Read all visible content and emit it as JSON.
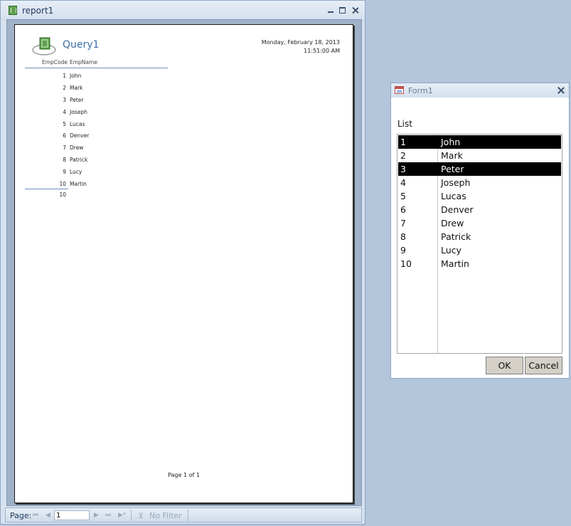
{
  "report_window": {
    "title": "report1",
    "report": {
      "title": "Query1",
      "date": "Monday, February 18, 2013",
      "time": "11:51:00 AM",
      "columns": [
        "EmpCode",
        "EmpName"
      ],
      "rows": [
        {
          "code": "1",
          "name": "John"
        },
        {
          "code": "2",
          "name": "Mark"
        },
        {
          "code": "3",
          "name": "Peter"
        },
        {
          "code": "4",
          "name": "Joseph"
        },
        {
          "code": "5",
          "name": "Lucas"
        },
        {
          "code": "6",
          "name": "Denver"
        },
        {
          "code": "7",
          "name": "Drew"
        },
        {
          "code": "8",
          "name": "Patrick"
        },
        {
          "code": "9",
          "name": "Lucy"
        },
        {
          "code": "10",
          "name": "Martin"
        }
      ],
      "total": "10",
      "footer": "Page 1 of 1"
    },
    "nav": {
      "label": "Page:",
      "page_value": "1",
      "filter_label": "No Filter"
    }
  },
  "form_window": {
    "title": "Form1",
    "list_label": "List",
    "items": [
      {
        "id": "1",
        "name": "John",
        "selected": true
      },
      {
        "id": "2",
        "name": "Mark",
        "selected": false
      },
      {
        "id": "3",
        "name": "Peter",
        "selected": true
      },
      {
        "id": "4",
        "name": "Joseph",
        "selected": false
      },
      {
        "id": "5",
        "name": "Lucas",
        "selected": false
      },
      {
        "id": "6",
        "name": "Denver",
        "selected": false
      },
      {
        "id": "7",
        "name": "Drew",
        "selected": false
      },
      {
        "id": "8",
        "name": "Patrick",
        "selected": false
      },
      {
        "id": "9",
        "name": "Lucy",
        "selected": false
      },
      {
        "id": "10",
        "name": "Martin",
        "selected": false
      }
    ],
    "ok_label": "OK",
    "cancel_label": "Cancel"
  }
}
